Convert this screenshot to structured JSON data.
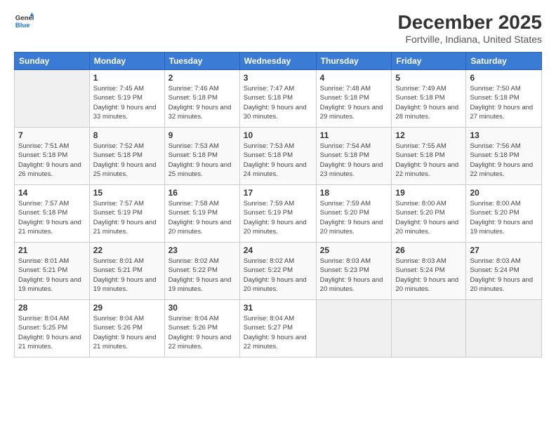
{
  "header": {
    "logo_line1": "General",
    "logo_line2": "Blue",
    "month": "December 2025",
    "location": "Fortville, Indiana, United States"
  },
  "weekdays": [
    "Sunday",
    "Monday",
    "Tuesday",
    "Wednesday",
    "Thursday",
    "Friday",
    "Saturday"
  ],
  "weeks": [
    [
      {
        "day": "",
        "sunrise": "",
        "sunset": "",
        "daylight": ""
      },
      {
        "day": "1",
        "sunrise": "Sunrise: 7:45 AM",
        "sunset": "Sunset: 5:19 PM",
        "daylight": "Daylight: 9 hours and 33 minutes."
      },
      {
        "day": "2",
        "sunrise": "Sunrise: 7:46 AM",
        "sunset": "Sunset: 5:18 PM",
        "daylight": "Daylight: 9 hours and 32 minutes."
      },
      {
        "day": "3",
        "sunrise": "Sunrise: 7:47 AM",
        "sunset": "Sunset: 5:18 PM",
        "daylight": "Daylight: 9 hours and 30 minutes."
      },
      {
        "day": "4",
        "sunrise": "Sunrise: 7:48 AM",
        "sunset": "Sunset: 5:18 PM",
        "daylight": "Daylight: 9 hours and 29 minutes."
      },
      {
        "day": "5",
        "sunrise": "Sunrise: 7:49 AM",
        "sunset": "Sunset: 5:18 PM",
        "daylight": "Daylight: 9 hours and 28 minutes."
      },
      {
        "day": "6",
        "sunrise": "Sunrise: 7:50 AM",
        "sunset": "Sunset: 5:18 PM",
        "daylight": "Daylight: 9 hours and 27 minutes."
      }
    ],
    [
      {
        "day": "7",
        "sunrise": "Sunrise: 7:51 AM",
        "sunset": "Sunset: 5:18 PM",
        "daylight": "Daylight: 9 hours and 26 minutes."
      },
      {
        "day": "8",
        "sunrise": "Sunrise: 7:52 AM",
        "sunset": "Sunset: 5:18 PM",
        "daylight": "Daylight: 9 hours and 25 minutes."
      },
      {
        "day": "9",
        "sunrise": "Sunrise: 7:53 AM",
        "sunset": "Sunset: 5:18 PM",
        "daylight": "Daylight: 9 hours and 25 minutes."
      },
      {
        "day": "10",
        "sunrise": "Sunrise: 7:53 AM",
        "sunset": "Sunset: 5:18 PM",
        "daylight": "Daylight: 9 hours and 24 minutes."
      },
      {
        "day": "11",
        "sunrise": "Sunrise: 7:54 AM",
        "sunset": "Sunset: 5:18 PM",
        "daylight": "Daylight: 9 hours and 23 minutes."
      },
      {
        "day": "12",
        "sunrise": "Sunrise: 7:55 AM",
        "sunset": "Sunset: 5:18 PM",
        "daylight": "Daylight: 9 hours and 22 minutes."
      },
      {
        "day": "13",
        "sunrise": "Sunrise: 7:56 AM",
        "sunset": "Sunset: 5:18 PM",
        "daylight": "Daylight: 9 hours and 22 minutes."
      }
    ],
    [
      {
        "day": "14",
        "sunrise": "Sunrise: 7:57 AM",
        "sunset": "Sunset: 5:18 PM",
        "daylight": "Daylight: 9 hours and 21 minutes."
      },
      {
        "day": "15",
        "sunrise": "Sunrise: 7:57 AM",
        "sunset": "Sunset: 5:19 PM",
        "daylight": "Daylight: 9 hours and 21 minutes."
      },
      {
        "day": "16",
        "sunrise": "Sunrise: 7:58 AM",
        "sunset": "Sunset: 5:19 PM",
        "daylight": "Daylight: 9 hours and 20 minutes."
      },
      {
        "day": "17",
        "sunrise": "Sunrise: 7:59 AM",
        "sunset": "Sunset: 5:19 PM",
        "daylight": "Daylight: 9 hours and 20 minutes."
      },
      {
        "day": "18",
        "sunrise": "Sunrise: 7:59 AM",
        "sunset": "Sunset: 5:20 PM",
        "daylight": "Daylight: 9 hours and 20 minutes."
      },
      {
        "day": "19",
        "sunrise": "Sunrise: 8:00 AM",
        "sunset": "Sunset: 5:20 PM",
        "daylight": "Daylight: 9 hours and 20 minutes."
      },
      {
        "day": "20",
        "sunrise": "Sunrise: 8:00 AM",
        "sunset": "Sunset: 5:20 PM",
        "daylight": "Daylight: 9 hours and 19 minutes."
      }
    ],
    [
      {
        "day": "21",
        "sunrise": "Sunrise: 8:01 AM",
        "sunset": "Sunset: 5:21 PM",
        "daylight": "Daylight: 9 hours and 19 minutes."
      },
      {
        "day": "22",
        "sunrise": "Sunrise: 8:01 AM",
        "sunset": "Sunset: 5:21 PM",
        "daylight": "Daylight: 9 hours and 19 minutes."
      },
      {
        "day": "23",
        "sunrise": "Sunrise: 8:02 AM",
        "sunset": "Sunset: 5:22 PM",
        "daylight": "Daylight: 9 hours and 19 minutes."
      },
      {
        "day": "24",
        "sunrise": "Sunrise: 8:02 AM",
        "sunset": "Sunset: 5:22 PM",
        "daylight": "Daylight: 9 hours and 20 minutes."
      },
      {
        "day": "25",
        "sunrise": "Sunrise: 8:03 AM",
        "sunset": "Sunset: 5:23 PM",
        "daylight": "Daylight: 9 hours and 20 minutes."
      },
      {
        "day": "26",
        "sunrise": "Sunrise: 8:03 AM",
        "sunset": "Sunset: 5:24 PM",
        "daylight": "Daylight: 9 hours and 20 minutes."
      },
      {
        "day": "27",
        "sunrise": "Sunrise: 8:03 AM",
        "sunset": "Sunset: 5:24 PM",
        "daylight": "Daylight: 9 hours and 20 minutes."
      }
    ],
    [
      {
        "day": "28",
        "sunrise": "Sunrise: 8:04 AM",
        "sunset": "Sunset: 5:25 PM",
        "daylight": "Daylight: 9 hours and 21 minutes."
      },
      {
        "day": "29",
        "sunrise": "Sunrise: 8:04 AM",
        "sunset": "Sunset: 5:26 PM",
        "daylight": "Daylight: 9 hours and 21 minutes."
      },
      {
        "day": "30",
        "sunrise": "Sunrise: 8:04 AM",
        "sunset": "Sunset: 5:26 PM",
        "daylight": "Daylight: 9 hours and 22 minutes."
      },
      {
        "day": "31",
        "sunrise": "Sunrise: 8:04 AM",
        "sunset": "Sunset: 5:27 PM",
        "daylight": "Daylight: 9 hours and 22 minutes."
      },
      {
        "day": "",
        "sunrise": "",
        "sunset": "",
        "daylight": ""
      },
      {
        "day": "",
        "sunrise": "",
        "sunset": "",
        "daylight": ""
      },
      {
        "day": "",
        "sunrise": "",
        "sunset": "",
        "daylight": ""
      }
    ]
  ]
}
